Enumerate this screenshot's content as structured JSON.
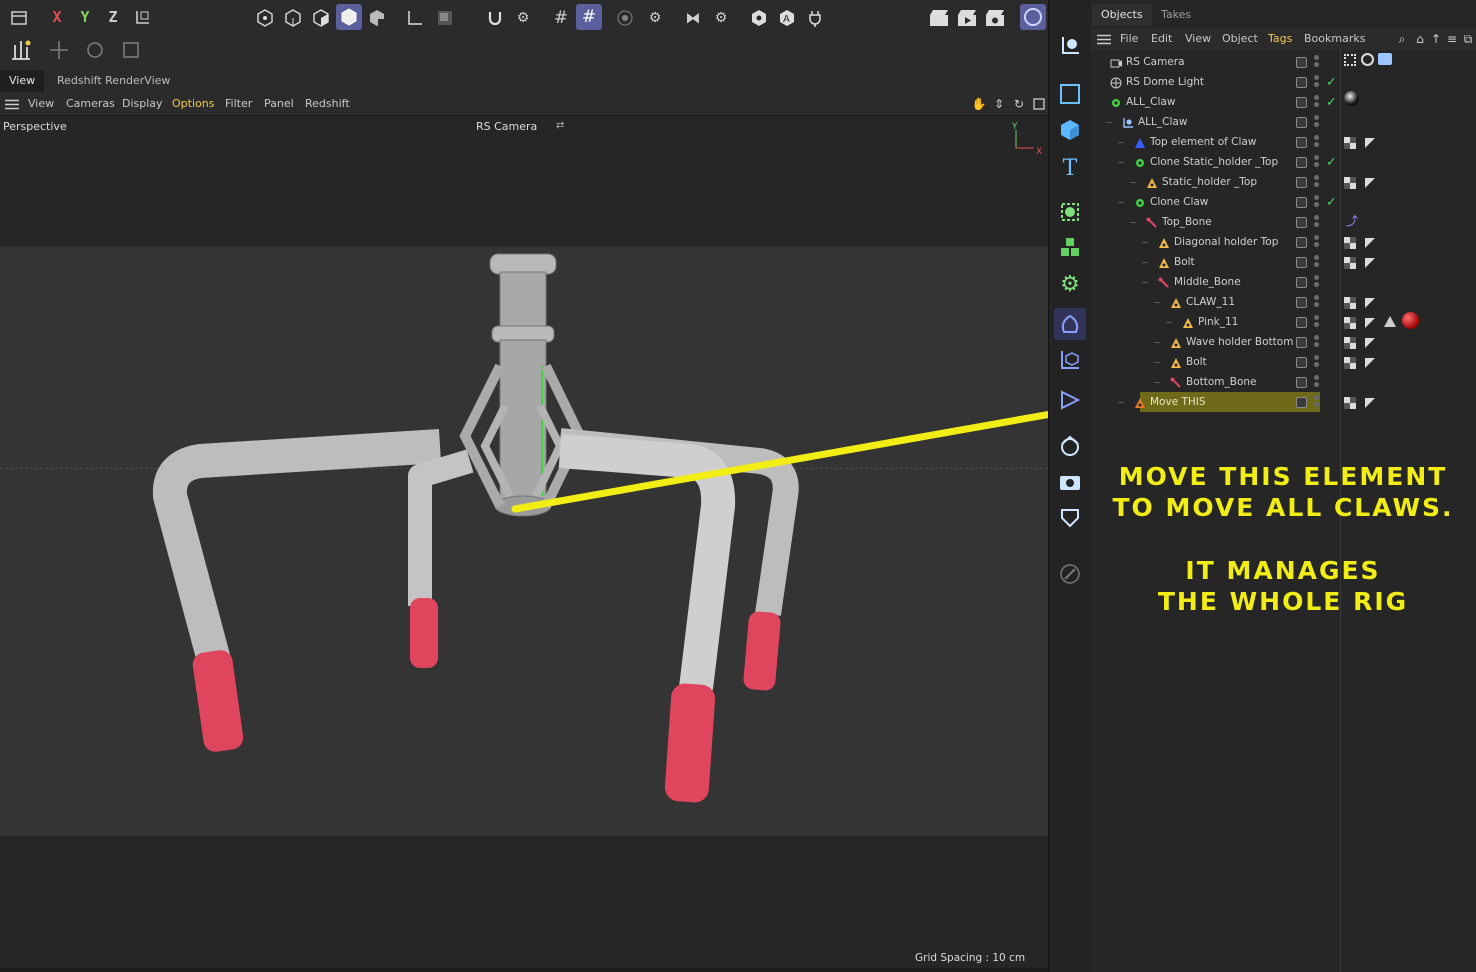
{
  "viewport": {
    "tabs": [
      "View",
      "Redshift RenderView"
    ],
    "menu": [
      "View",
      "Cameras",
      "Display",
      "Options",
      "Filter",
      "Panel",
      "Redshift"
    ],
    "active_menu": "Options",
    "projection": "Perspective",
    "camera": "RS Camera",
    "grid_spacing": "Grid Spacing : 10 cm",
    "axis": {
      "y": "Y",
      "x": "X"
    }
  },
  "toolbar": {
    "axes": [
      "X",
      "Y",
      "Z"
    ]
  },
  "object_manager": {
    "tabs": [
      "Objects",
      "Takes"
    ],
    "menu": [
      "File",
      "Edit",
      "View",
      "Object",
      "Tags",
      "Bookmarks"
    ],
    "active_menu": "Tags",
    "rows": [
      {
        "name": "RS Camera",
        "icon": "camera-icon",
        "depth": 0,
        "check": false
      },
      {
        "name": "RS Dome Light",
        "icon": "globe-icon",
        "depth": 0,
        "check": true
      },
      {
        "name": "ALL_Claw",
        "icon": "cloner-icon",
        "depth": 0,
        "check": true
      },
      {
        "name": "ALL_Claw",
        "icon": "null-icon",
        "depth": 1,
        "check": false
      },
      {
        "name": "Top element of Claw",
        "icon": "cone-icon",
        "depth": 2,
        "check": false
      },
      {
        "name": "Clone Static_holder _Top",
        "icon": "cloner-icon",
        "depth": 2,
        "check": true
      },
      {
        "name": "Static_holder _Top",
        "icon": "poly-icon",
        "depth": 3,
        "check": false
      },
      {
        "name": "Clone Claw",
        "icon": "cloner-icon",
        "depth": 2,
        "check": true
      },
      {
        "name": "Top_Bone",
        "icon": "bone-icon",
        "depth": 3,
        "check": false
      },
      {
        "name": "Diagonal  holder Top",
        "icon": "poly-icon",
        "depth": 4,
        "check": false
      },
      {
        "name": "Bolt",
        "icon": "poly-icon",
        "depth": 4,
        "check": false
      },
      {
        "name": "Middle_Bone",
        "icon": "bone-icon",
        "depth": 4,
        "check": false
      },
      {
        "name": "CLAW_11",
        "icon": "poly-icon",
        "depth": 5,
        "check": false
      },
      {
        "name": "Pink_11",
        "icon": "poly-icon",
        "depth": 6,
        "check": false
      },
      {
        "name": "Wave holder Bottom",
        "icon": "poly-icon",
        "depth": 5,
        "check": false
      },
      {
        "name": "Bolt",
        "icon": "poly-icon",
        "depth": 5,
        "check": false
      },
      {
        "name": "Bottom_Bone",
        "icon": "bone-icon",
        "depth": 5,
        "check": false
      },
      {
        "name": "Move THIS",
        "icon": "poly-icon-orange",
        "depth": 2,
        "check": false,
        "highlight": true
      }
    ]
  },
  "annotation": {
    "line1": "MOVE THIS ELEMENT",
    "line2": "TO MOVE ALL CLAWS.",
    "line3": "IT MANAGES",
    "line4": "THE WHOLE RIG",
    "color": "#f2ee15"
  }
}
